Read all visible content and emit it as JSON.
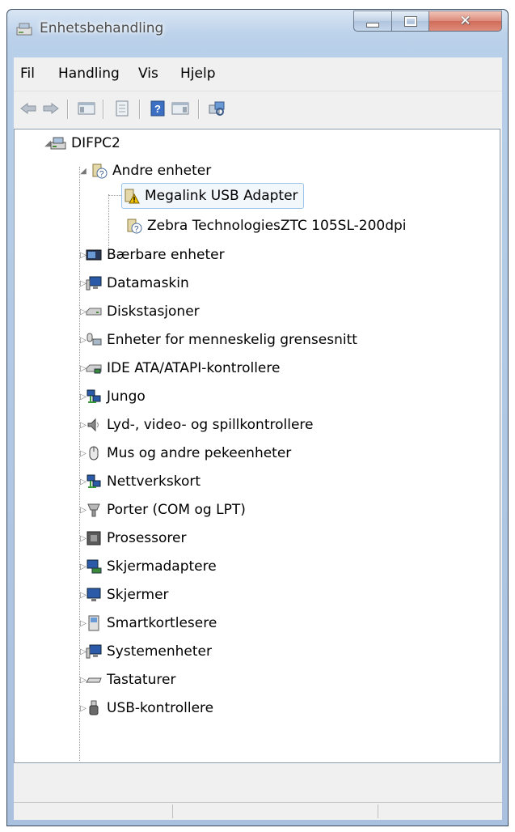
{
  "window": {
    "title": "Enhetsbehandling"
  },
  "menu": [
    "Fil",
    "Handling",
    "Vis",
    "Hjelp"
  ],
  "toolbar": {
    "buttons": [
      "back-icon",
      "forward-icon",
      "show-hide-console-tree-icon",
      "properties-icon",
      "help-icon",
      "show-action-pane-icon",
      "scan-hardware-icon"
    ]
  },
  "tree": {
    "root": "DIFPC2",
    "other_devices": "Andre enheter",
    "other_children": [
      "Megalink USB Adapter",
      "Zebra TechnologiesZTC 105SL-200dpi"
    ],
    "categories": [
      "Bærbare enheter",
      "Datamaskin",
      "Diskstasjoner",
      "Enheter for menneskelig grensesnitt",
      "IDE ATA/ATAPI-kontrollere",
      "Jungo",
      "Lyd-, video- og spillkontrollere",
      "Mus og andre pekeenheter",
      "Nettverkskort",
      "Porter (COM og LPT)",
      "Prosessorer",
      "Skjermadaptere",
      "Skjermer",
      "Smartkortlesere",
      "Systemenheter",
      "Tastaturer",
      "USB-kontrollere"
    ],
    "selected": "Megalink USB Adapter"
  },
  "colors": {
    "selection_border": "#9cc3ea",
    "warning": "#f2c200",
    "close_button": "#c0381f"
  }
}
